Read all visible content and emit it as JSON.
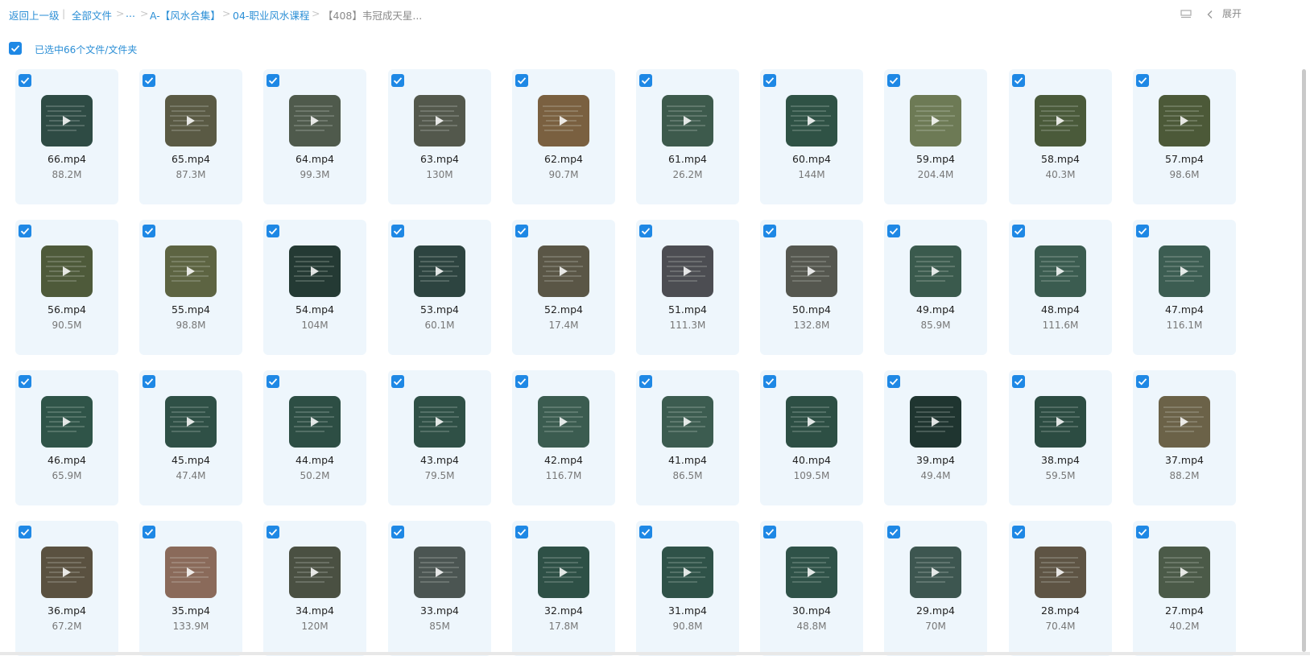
{
  "breadcrumb": {
    "back": "返回上一级",
    "sep_bar": "|",
    "root": "全部文件",
    "sep": ">",
    "ellipsis": "...",
    "level1": "A-【风水合集】",
    "level2": "04-职业风水课程",
    "current": "【408】韦冠成天星..."
  },
  "toolbar": {
    "expand_label": "展开"
  },
  "selection": {
    "label": "已选中66个文件/文件夹"
  },
  "files": [
    {
      "name": "66.mp4",
      "size": "88.2M",
      "thumb": "#2e4b44"
    },
    {
      "name": "65.mp4",
      "size": "87.3M",
      "thumb": "#5a5a44"
    },
    {
      "name": "64.mp4",
      "size": "99.3M",
      "thumb": "#4f5a4c"
    },
    {
      "name": "63.mp4",
      "size": "130M",
      "thumb": "#53584c"
    },
    {
      "name": "62.mp4",
      "size": "90.7M",
      "thumb": "#7a6040"
    },
    {
      "name": "61.mp4",
      "size": "26.2M",
      "thumb": "#3d5a4c"
    },
    {
      "name": "60.mp4",
      "size": "144M",
      "thumb": "#2f5245"
    },
    {
      "name": "59.mp4",
      "size": "204.4M",
      "thumb": "#6d7a55"
    },
    {
      "name": "58.mp4",
      "size": "40.3M",
      "thumb": "#4a5a3a"
    },
    {
      "name": "57.mp4",
      "size": "98.6M",
      "thumb": "#4c5938"
    },
    {
      "name": "56.mp4",
      "size": "90.5M",
      "thumb": "#4e5a3a"
    },
    {
      "name": "55.mp4",
      "size": "98.8M",
      "thumb": "#5d6442"
    },
    {
      "name": "54.mp4",
      "size": "104M",
      "thumb": "#243a34"
    },
    {
      "name": "53.mp4",
      "size": "60.1M",
      "thumb": "#2d4440"
    },
    {
      "name": "52.mp4",
      "size": "17.4M",
      "thumb": "#5a5646"
    },
    {
      "name": "51.mp4",
      "size": "111.3M",
      "thumb": "#4c4d52"
    },
    {
      "name": "50.mp4",
      "size": "132.8M",
      "thumb": "#55574f"
    },
    {
      "name": "49.mp4",
      "size": "85.9M",
      "thumb": "#3a5a4d"
    },
    {
      "name": "48.mp4",
      "size": "111.6M",
      "thumb": "#3b5c50"
    },
    {
      "name": "47.mp4",
      "size": "116.1M",
      "thumb": "#3c5d52"
    },
    {
      "name": "46.mp4",
      "size": "65.9M",
      "thumb": "#2f5448"
    },
    {
      "name": "45.mp4",
      "size": "47.4M",
      "thumb": "#2f5046"
    },
    {
      "name": "44.mp4",
      "size": "50.2M",
      "thumb": "#2d4e44"
    },
    {
      "name": "43.mp4",
      "size": "79.5M",
      "thumb": "#2f5046"
    },
    {
      "name": "42.mp4",
      "size": "116.7M",
      "thumb": "#3b5c50"
    },
    {
      "name": "41.mp4",
      "size": "86.5M",
      "thumb": "#3c5c50"
    },
    {
      "name": "40.mp4",
      "size": "109.5M",
      "thumb": "#2d4f44"
    },
    {
      "name": "39.mp4",
      "size": "49.4M",
      "thumb": "#1f3530"
    },
    {
      "name": "38.mp4",
      "size": "59.5M",
      "thumb": "#2c4c42"
    },
    {
      "name": "37.mp4",
      "size": "88.2M",
      "thumb": "#6b6248"
    },
    {
      "name": "36.mp4",
      "size": "67.2M",
      "thumb": "#5a5140"
    },
    {
      "name": "35.mp4",
      "size": "133.9M",
      "thumb": "#8a6a5a"
    },
    {
      "name": "34.mp4",
      "size": "120M",
      "thumb": "#4a5042"
    },
    {
      "name": "33.mp4",
      "size": "85M",
      "thumb": "#4b5552"
    },
    {
      "name": "32.mp4",
      "size": "17.8M",
      "thumb": "#2e5046"
    },
    {
      "name": "31.mp4",
      "size": "90.8M",
      "thumb": "#2f5248"
    },
    {
      "name": "30.mp4",
      "size": "48.8M",
      "thumb": "#2f5248"
    },
    {
      "name": "29.mp4",
      "size": "70M",
      "thumb": "#3d5650"
    },
    {
      "name": "28.mp4",
      "size": "70.4M",
      "thumb": "#5e5444"
    },
    {
      "name": "27.mp4",
      "size": "40.2M",
      "thumb": "#4b5a48"
    }
  ]
}
